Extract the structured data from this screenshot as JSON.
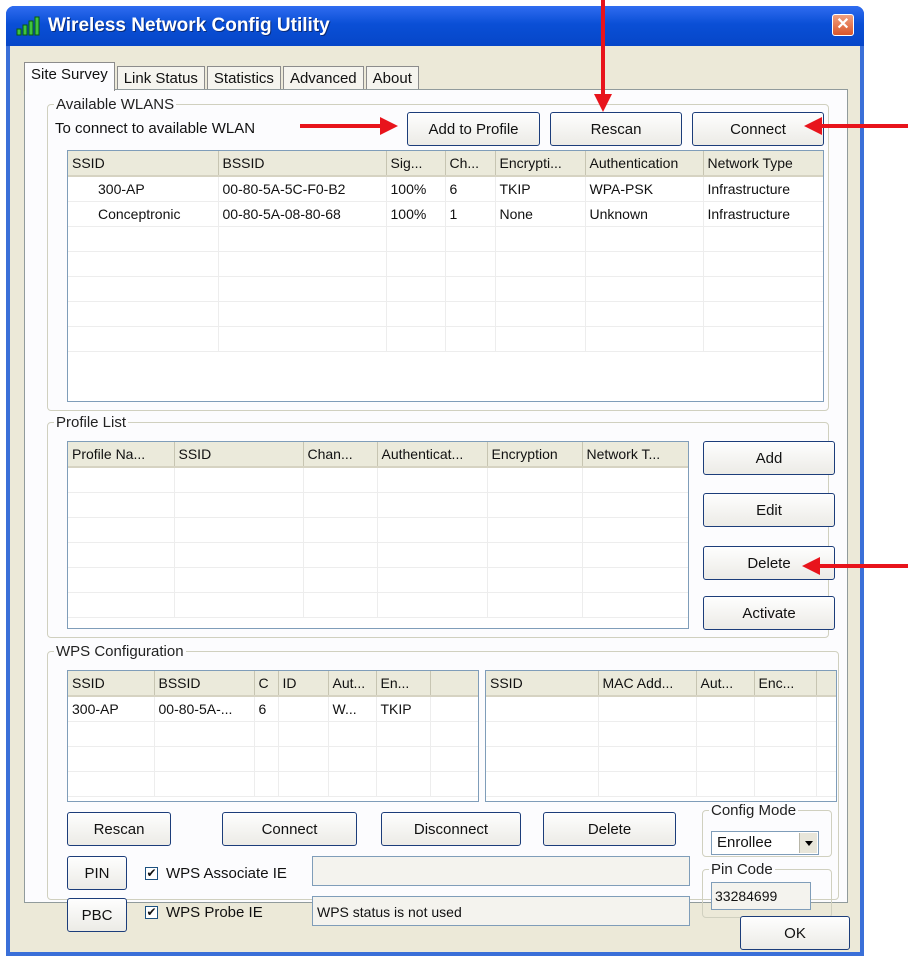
{
  "window": {
    "title": "Wireless Network Config Utility",
    "close_glyph": "✕"
  },
  "tabs": [
    "Site Survey",
    "Link Status",
    "Statistics",
    "Advanced",
    "About"
  ],
  "available": {
    "legend": "Available WLANS",
    "hint": "To connect to available WLAN",
    "add_to_profile": "Add to Profile",
    "rescan": "Rescan",
    "connect": "Connect",
    "columns": [
      "SSID",
      "BSSID",
      "Sig...",
      "Ch...",
      "Encrypti...",
      "Authentication",
      "Network Type"
    ],
    "rows": [
      [
        "300-AP",
        "00-80-5A-5C-F0-B2",
        "100%",
        "6",
        "TKIP",
        "WPA-PSK",
        "Infrastructure"
      ],
      [
        "Conceptronic",
        "00-80-5A-08-80-68",
        "100%",
        "1",
        "None",
        "Unknown",
        "Infrastructure"
      ]
    ]
  },
  "profiles": {
    "legend": "Profile List",
    "columns": [
      "Profile Na...",
      "SSID",
      "Chan...",
      "Authenticat...",
      "Encryption",
      "Network T..."
    ],
    "add": "Add",
    "edit": "Edit",
    "delete": "Delete",
    "activate": "Activate"
  },
  "wps": {
    "legend": "WPS Configuration",
    "left_columns": [
      "SSID",
      "BSSID",
      "C",
      "ID",
      "Aut...",
      "En..."
    ],
    "left_rows": [
      [
        "300-AP",
        "00-80-5A-...",
        "6",
        "",
        "W...",
        "TKIP"
      ]
    ],
    "right_columns": [
      "SSID",
      "MAC Add...",
      "Aut...",
      "Enc..."
    ],
    "rescan": "Rescan",
    "connect": "Connect",
    "disconnect": "Disconnect",
    "delete": "Delete",
    "config_mode_label": "Config Mode",
    "config_mode_value": "Enrollee",
    "pin": "PIN",
    "pbc": "PBC",
    "wps_associate_ie": "WPS Associate IE",
    "wps_probe_ie": "WPS Probe IE",
    "status": "WPS status is not used",
    "pin_code_label": "Pin Code",
    "pin_code_value": "33284699",
    "check_glyph": "✔"
  },
  "ok": "OK",
  "colors": {
    "annotation_arrow": "#e8141c",
    "title_bar": "#0a4fd6"
  }
}
